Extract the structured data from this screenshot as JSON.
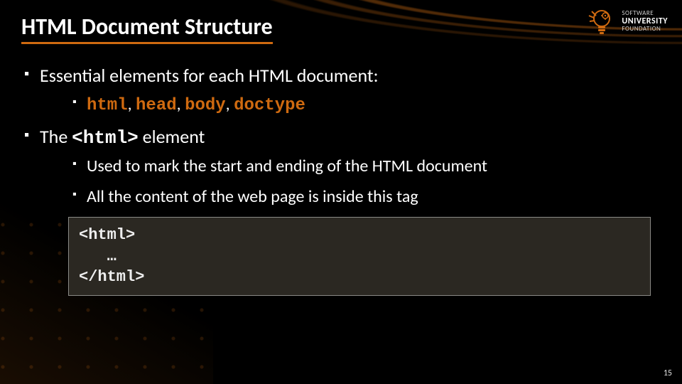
{
  "title": "HTML Document Structure",
  "logo": {
    "line1": "SOFTWARE",
    "line2": "UNIVERSITY",
    "line3": "FOUNDATION",
    "icon": "lightbulb-gear-icon"
  },
  "bullets": {
    "b1": "Essential elements for each HTML document:",
    "b1_sub": {
      "kw_html": "html",
      "sep1": ", ",
      "kw_head": "head",
      "sep2": ", ",
      "kw_body": "body",
      "sep3": ", ",
      "kw_doctype": "doctype"
    },
    "b2_pre": "The ",
    "b2_kw": "<html>",
    "b2_post": " element",
    "b2_sub1": "Used to mark the start and ending of the HTML document",
    "b2_sub2": "All the content of the web page is inside this tag"
  },
  "code": "<html>\n   …\n</html>",
  "page_number": "15"
}
